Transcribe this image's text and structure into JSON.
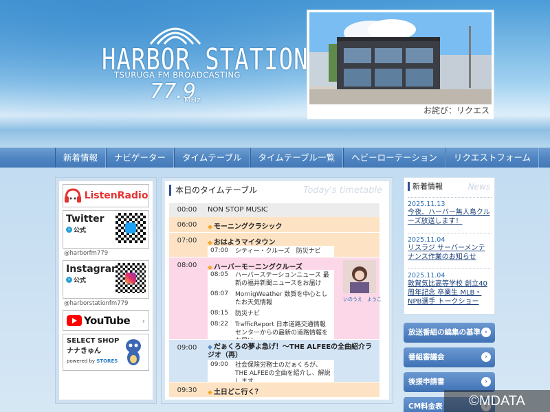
{
  "header": {
    "logo": {
      "title": "HARBOR STATION",
      "subtitle": "TSURUGA FM BROADCASTING",
      "frequency": "77.9",
      "unit": "MHz"
    },
    "photo_caption": "お詫び：リクエス"
  },
  "nav": {
    "items": [
      {
        "label": "新着情報"
      },
      {
        "label": "ナビゲーター"
      },
      {
        "label": "タイムテーブル"
      },
      {
        "label": "タイムテーブル一覧"
      },
      {
        "label": "ヘビーローテーション"
      },
      {
        "label": "リクエストフォーム"
      }
    ]
  },
  "left": {
    "listenradio": {
      "label": "ListenRadio"
    },
    "twitter": {
      "title": "Twitter",
      "official": "公式",
      "handle": "@harborfm779"
    },
    "instagram": {
      "title": "Instagram",
      "official": "公式",
      "handle": "@harborstationfm779"
    },
    "youtube": {
      "label": "YouTube"
    },
    "shop": {
      "title": "SELECT SHOP",
      "subtitle": "ナナきゅん",
      "powered_by": "powered by",
      "stores": "STORES"
    }
  },
  "timetable": {
    "title": "本日のタイムテーブル",
    "title_en": "Today's timetable",
    "rows": [
      {
        "time": "00:00",
        "program": "NON STOP MUSIC"
      },
      {
        "time": "06:00",
        "program": "モーニングクラシック"
      },
      {
        "time": "07:00",
        "program": "おはようマイタウン",
        "sub": [
          {
            "time": "07:00",
            "text": "シティー・クルーズ　防災ナビ"
          }
        ]
      },
      {
        "time": "08:00",
        "program": "ハーバーモーニングクルーズ",
        "sub": [
          {
            "time": "08:05",
            "text": "ハーバーステーションニュース 最新の福井新聞ニュースをお届け"
          },
          {
            "time": "08:07",
            "text": "MornigWeather 数賀を中心としたお天気情報"
          },
          {
            "time": "08:15",
            "text": "防災ナビ"
          },
          {
            "time": "08:22",
            "text": "TrafficReport 日本道路交通情報センターからの最新の道路情報をお届け"
          }
        ],
        "person": "いのうえ　ようこ"
      },
      {
        "time": "09:00",
        "program": "だぁくろの夢よ急げ！〜THE ALFEEの全曲紹介ラジオ（再）",
        "sub": [
          {
            "time": "09:00",
            "text": "社会保険労務士のだぁくろが、THE ALFEEの全曲を紹介し、解説します。"
          }
        ]
      },
      {
        "time": "09:30",
        "program": "土日どこ行く？"
      }
    ]
  },
  "news": {
    "title": "新着情報",
    "title_en": "News",
    "items": [
      {
        "date": "2025.11.13",
        "text": "今夜、ハーバー無人島クルーズ放送します！"
      },
      {
        "date": "2025.11.04",
        "text": "リスラジ サーバーメンテナンス作業のお知らせ"
      },
      {
        "date": "2025.11.04",
        "text": "敦賀気比高等学校 創立40周年記念 卒業生 MLB・NPB選手 トークショー"
      }
    ]
  },
  "side_buttons": [
    {
      "label": "放送番組の編集の基準"
    },
    {
      "label": "番組審議会"
    },
    {
      "label": "後援申請書"
    },
    {
      "label": "CM料金表"
    }
  ],
  "copyright": "©MDATA",
  "colors": {
    "accent": "#4479b8",
    "timeslot_orange": "#fde3c4",
    "timeslot_pink": "#fbd7e8",
    "timeslot_blue": "#d3e4f5",
    "timeslot_gray": "#ececec"
  }
}
